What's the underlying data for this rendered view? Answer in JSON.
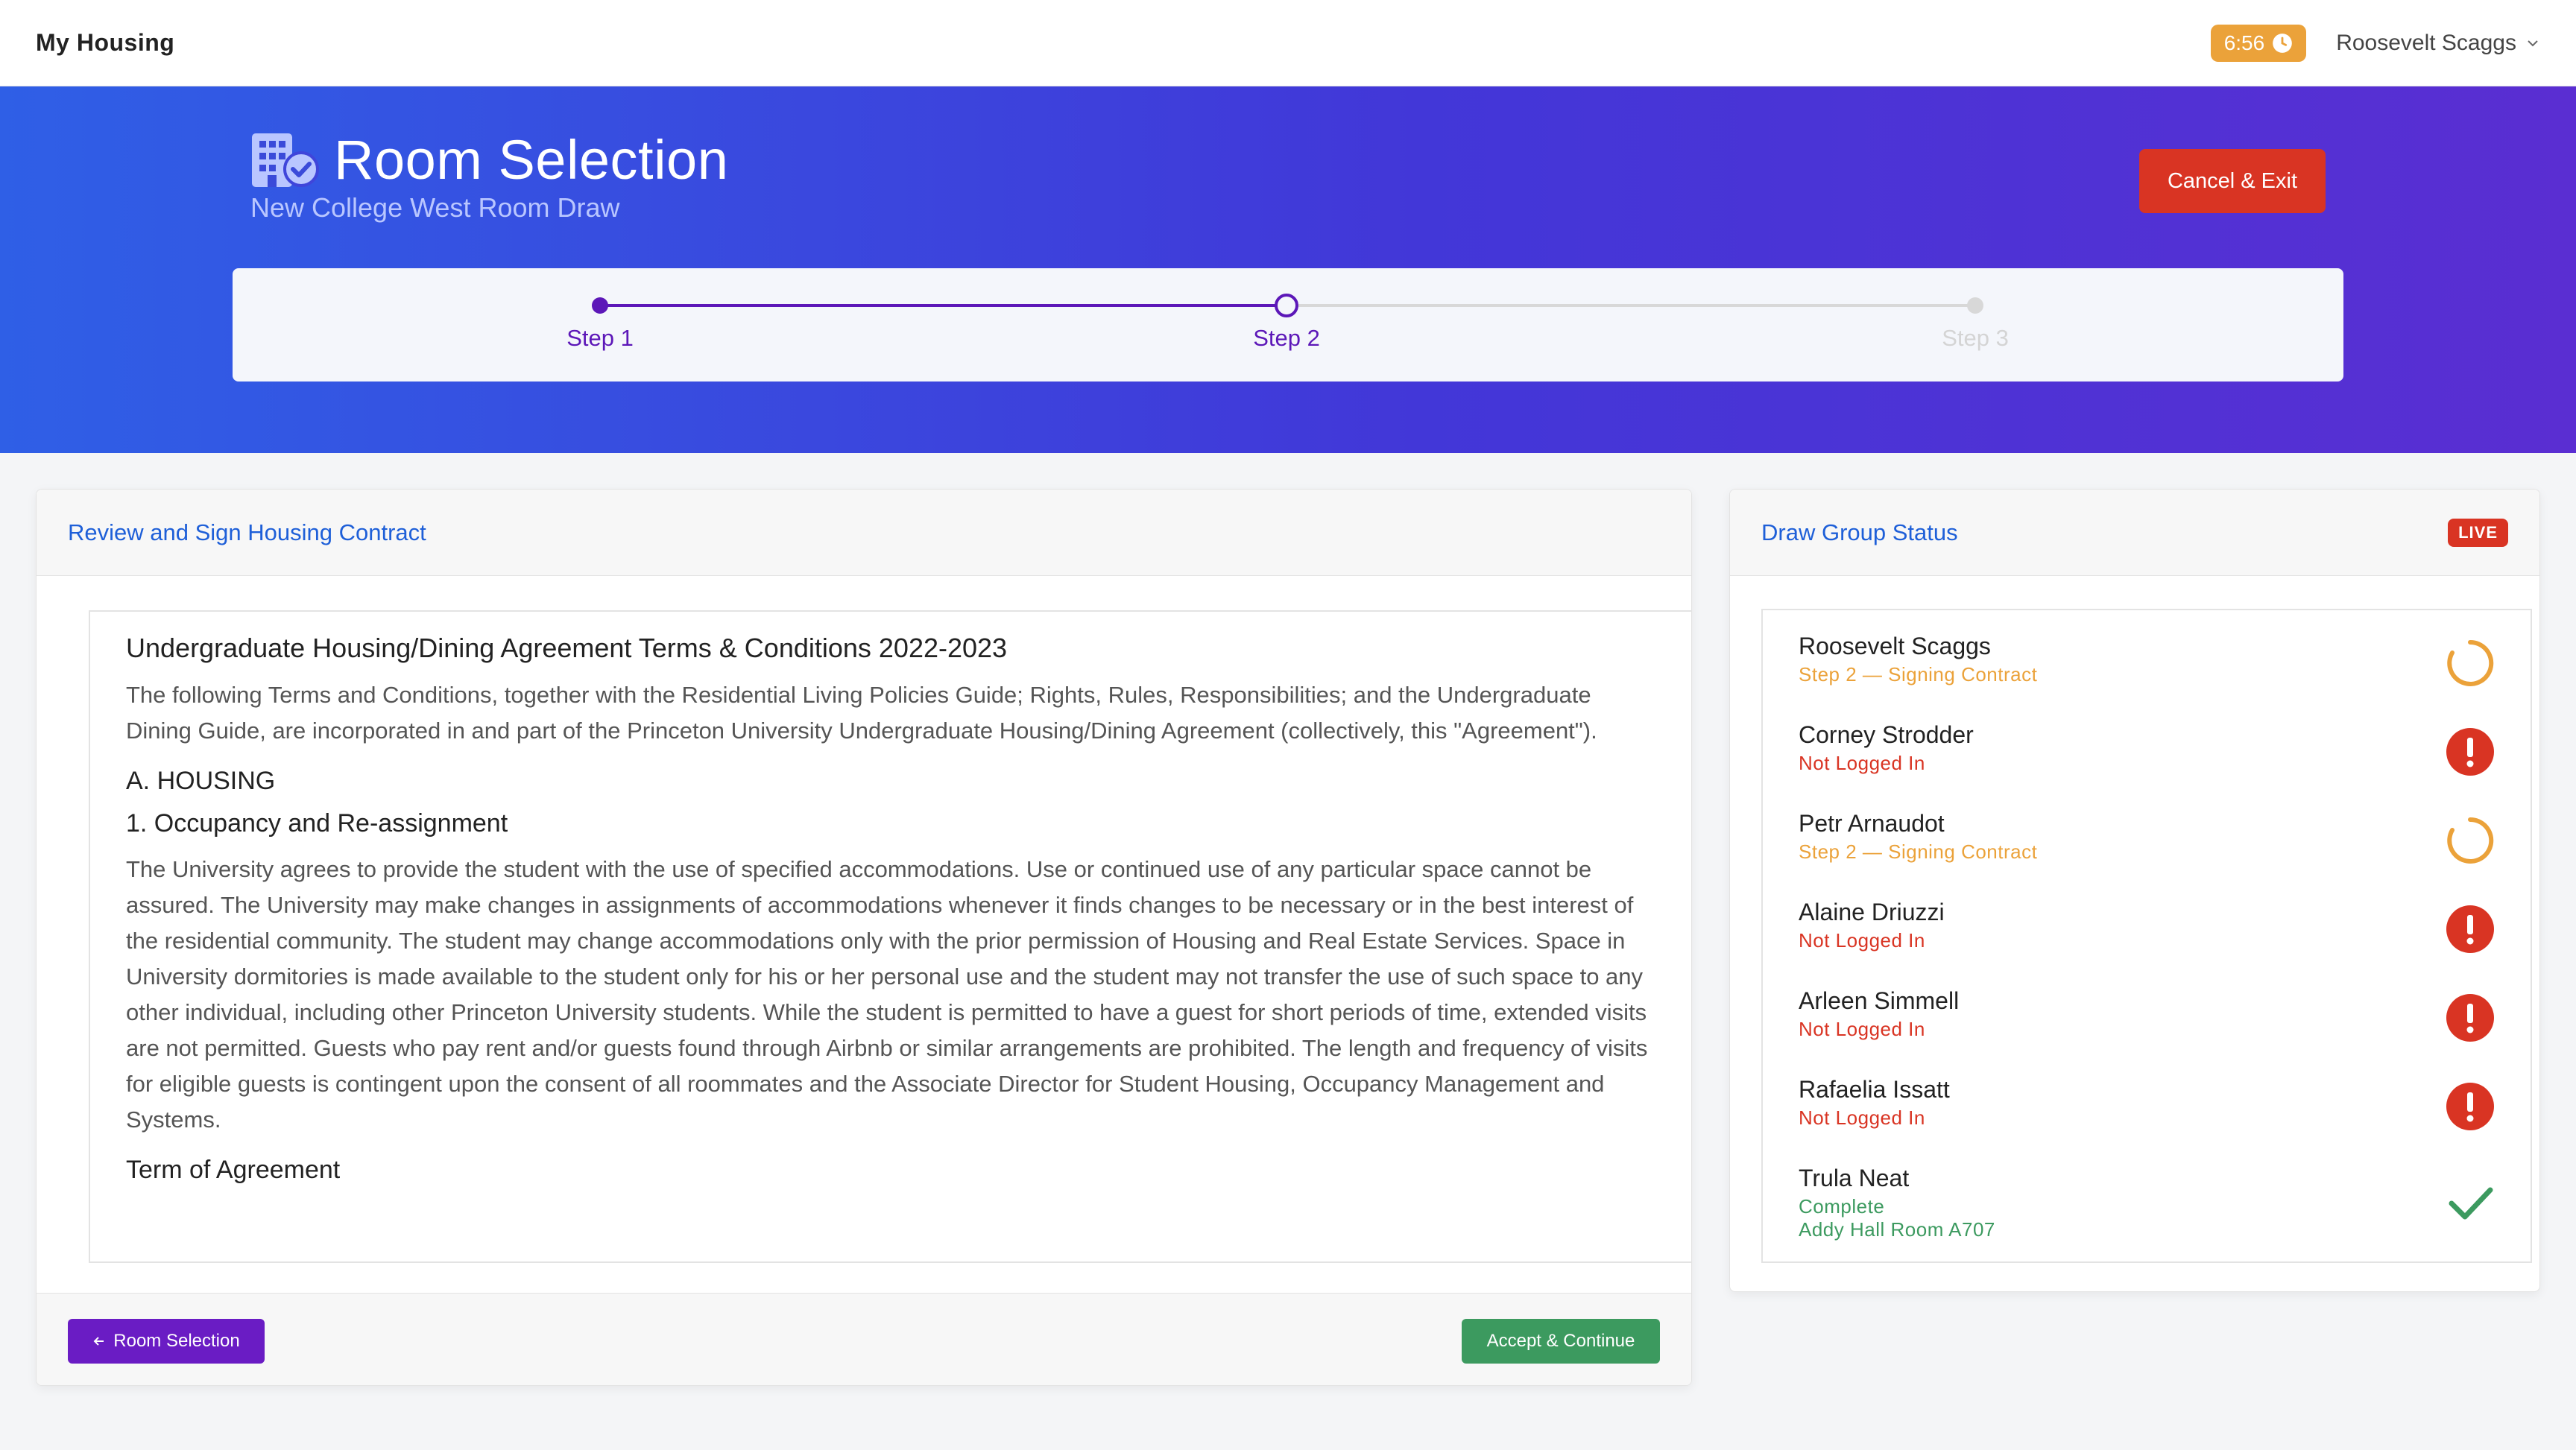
{
  "app": {
    "brand": "My Housing",
    "timer": "6:56",
    "user_name": "Roosevelt Scaggs"
  },
  "hero": {
    "title": "Room Selection",
    "subtitle": "New College West Room Draw",
    "cancel_label": "Cancel & Exit"
  },
  "steps": [
    {
      "label": "Step 1",
      "state": "complete"
    },
    {
      "label": "Step 2",
      "state": "current"
    },
    {
      "label": "Step 3",
      "state": "upcoming"
    }
  ],
  "contract": {
    "panel_title": "Review and Sign Housing Contract",
    "heading": "Undergraduate Housing/Dining Agreement Terms & Conditions 2022-2023",
    "intro": "The following Terms and Conditions, together with the Residential Living Policies Guide; Rights, Rules, Responsibilities; and the Undergraduate Dining Guide, are incorporated in and part of the Princeton University Undergraduate Housing/Dining Agreement (collectively, this \"Agreement\").",
    "section_a": "A. HOUSING",
    "section_1": "1. Occupancy and Re-assignment",
    "section_1_body": "The University agrees to provide the student with the use of specified accommodations. Use or continued use of any particular space cannot be assured. The University may make changes in assignments of accommodations whenever it finds changes to be necessary or in the best interest of the residential community. The student may change accommodations only with the prior permission of Housing and Real Estate Services. Space in University dormitories is made available to the student only for his or her personal use and the student may not transfer the use of such space to any other individual, including other Princeton University students. While the student is permitted to have a guest for short periods of time, extended visits are not permitted. Guests who pay rent and/or guests found through Airbnb or similar arrangements are prohibited. The length and frequency of visits for eligible guests is contingent upon the consent of all roommates and the Associate Director for Student Housing, Occupancy Management and Systems.",
    "next_heading": "Term of Agreement",
    "back_label": "Room Selection",
    "accept_label": "Accept & Continue"
  },
  "status": {
    "panel_title": "Draw Group Status",
    "live_label": "LIVE",
    "members": [
      {
        "name": "Roosevelt Scaggs",
        "status": "Step 2 — Signing Contract",
        "state": "progress",
        "color": "#eba23a",
        "icon": "spinner-icon"
      },
      {
        "name": "Corney Strodder",
        "status": "Not Logged In",
        "state": "error",
        "color": "#d93423",
        "icon": "alert-icon"
      },
      {
        "name": "Petr Arnaudot",
        "status": "Step 2 — Signing Contract",
        "state": "progress",
        "color": "#eba23a",
        "icon": "spinner-icon"
      },
      {
        "name": "Alaine Driuzzi",
        "status": "Not Logged In",
        "state": "error",
        "color": "#d93423",
        "icon": "alert-icon"
      },
      {
        "name": "Arleen Simmell",
        "status": "Not Logged In",
        "state": "error",
        "color": "#d93423",
        "icon": "alert-icon"
      },
      {
        "name": "Rafaelia Issatt",
        "status": "Not Logged In",
        "state": "error",
        "color": "#d93423",
        "icon": "alert-icon"
      },
      {
        "name": "Trula Neat",
        "status": "Complete",
        "extra": "Addy Hall Room A707",
        "state": "complete",
        "color": "#3c9a5f",
        "icon": "check-icon"
      }
    ]
  },
  "colors": {
    "accent_purple": "#6a1cc4",
    "link_blue": "#1e5fd8",
    "danger": "#d93423",
    "warning": "#eba23a",
    "success": "#3c9a5f"
  }
}
